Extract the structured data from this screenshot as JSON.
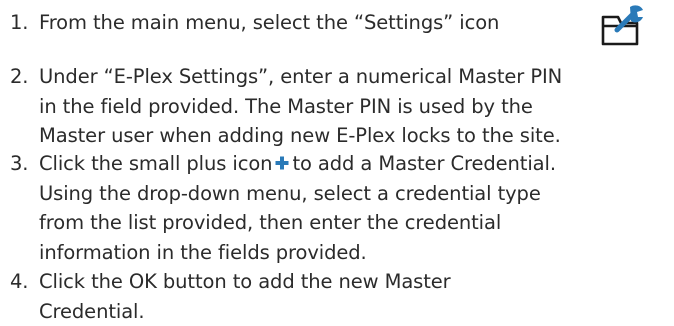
{
  "steps": [
    {
      "number": "1.",
      "text": "From the main menu, select the “Settings” icon"
    },
    {
      "number": "2.",
      "lines": [
        "Under “E-Plex Settings”, enter a numerical Master PIN",
        "in the field provided.  The Master PIN is used by the",
        "Master user when adding new E-Plex locks to the site."
      ]
    },
    {
      "number": "3.",
      "first_before_icon": "Click the small plus icon",
      "first_after_icon": "to add a Master Credential.",
      "lines": [
        "Using the drop-down menu, select a credential type",
        "from the list provided, then enter the credential",
        "information in the fields provided."
      ]
    },
    {
      "number": "4.",
      "lines": [
        "Click the OK button to add the new Master",
        "Credential."
      ]
    }
  ],
  "icons": {
    "settings": "settings-folder-wrench-icon",
    "plus": "plus-icon"
  },
  "colors": {
    "text": "#2b2b2b",
    "icon_blue": "#2a7ab8",
    "icon_dark": "#1a1a1a"
  }
}
